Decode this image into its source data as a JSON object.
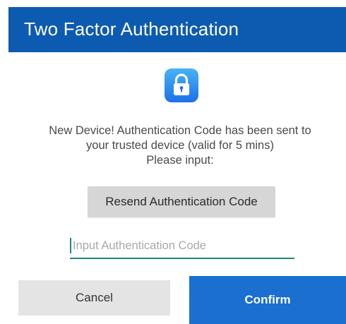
{
  "dialog": {
    "title": "Two Factor Authentication",
    "icon": "lock-icon",
    "message_lines": [
      "New Device! Authentication Code has been sent to",
      "your trusted device (valid for 5 mins)",
      "Please input:"
    ],
    "resend_label": "Resend Authentication Code",
    "code_input": {
      "value": "",
      "placeholder": "Input Authentication Code"
    },
    "cancel_label": "Cancel",
    "confirm_label": "Confirm"
  },
  "colors": {
    "header_bg": "#0d5bb0",
    "confirm_bg": "#1a6fd0",
    "icon_gradient_top": "#47b3f7",
    "icon_gradient_bottom": "#1d70e8",
    "input_underline": "#1e8a79",
    "resend_bg": "#d6d6d6",
    "cancel_bg": "#e4e4e4"
  }
}
